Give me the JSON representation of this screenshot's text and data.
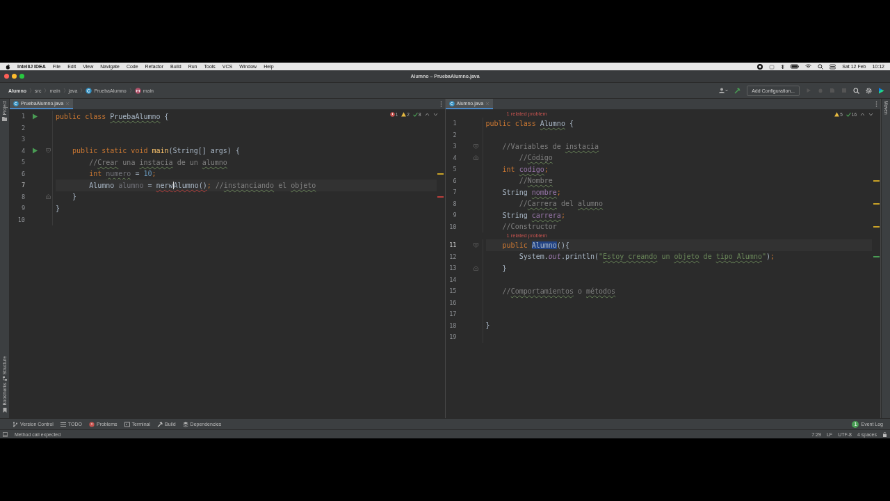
{
  "menubar": {
    "app": "IntelliJ IDEA",
    "items": [
      "File",
      "Edit",
      "View",
      "Navigate",
      "Code",
      "Refactor",
      "Build",
      "Run",
      "Tools",
      "VCS",
      "Window",
      "Help"
    ],
    "date": "Sat 12 Feb",
    "time": "10:12"
  },
  "window": {
    "title": "Alumno – PruebaAlumno.java"
  },
  "breadcrumbs": [
    {
      "text": "Alumno",
      "kind": "project"
    },
    {
      "text": "src",
      "kind": "folder"
    },
    {
      "text": "main",
      "kind": "folder"
    },
    {
      "text": "java",
      "kind": "folder"
    },
    {
      "text": "PruebaAlumno",
      "kind": "class"
    },
    {
      "text": "main",
      "kind": "method"
    }
  ],
  "toolbar": {
    "run_config": "Add Configuration..."
  },
  "side_left": [
    "Project",
    "Structure",
    "Bookmarks"
  ],
  "side_right": [
    "Maven"
  ],
  "panes": [
    {
      "tab": {
        "label": "PruebaAlumno.java",
        "selected": true
      },
      "inspections": [
        {
          "kind": "error",
          "count": "1"
        },
        {
          "kind": "warning",
          "count": "2"
        },
        {
          "kind": "ok",
          "count": "8"
        }
      ],
      "lines": [
        {
          "number": "1",
          "current": false,
          "run": true,
          "tokens": [
            {
              "text": "public class ",
              "kind": "keyword"
            },
            {
              "text": "PruebaAlumno",
              "kind": "plain",
              "typo": true
            },
            {
              "text": " {",
              "kind": "plain"
            }
          ]
        },
        {
          "number": "2",
          "current": false
        },
        {
          "number": "3",
          "current": false
        },
        {
          "number": "4",
          "current": false,
          "run": true,
          "fold_start": true,
          "tokens": [
            {
              "text": "    public static void ",
              "kind": "keyword"
            },
            {
              "text": "main",
              "kind": "method"
            },
            {
              "text": "(String[] args) {",
              "kind": "plain"
            }
          ]
        },
        {
          "number": "5",
          "current": false,
          "tokens": [
            {
              "text": "        //",
              "kind": "comment"
            },
            {
              "text": "Crear",
              "kind": "comment",
              "typo": true
            },
            {
              "text": " una ",
              "kind": "comment"
            },
            {
              "text": "instacia",
              "kind": "comment",
              "typo": true
            },
            {
              "text": " de un ",
              "kind": "comment"
            },
            {
              "text": "alumno",
              "kind": "comment",
              "typo": true
            }
          ]
        },
        {
          "number": "6",
          "current": false,
          "stripe": {
            "color": "#c9a227"
          },
          "tokens": [
            {
              "text": "        int ",
              "kind": "keyword"
            },
            {
              "text": "numero",
              "kind": "unused",
              "typo": true
            },
            {
              "text": " = ",
              "kind": "plain"
            },
            {
              "text": "10",
              "kind": "number"
            },
            {
              "text": ";",
              "kind": "keyword"
            }
          ]
        },
        {
          "number": "7",
          "current": true,
          "tokens": [
            {
              "text": "        Alumno ",
              "kind": "plain"
            },
            {
              "text": "alumno",
              "kind": "unused"
            },
            {
              "text": " = ",
              "kind": "plain"
            },
            {
              "text": "nerw",
              "kind": "plain",
              "error": true,
              "caret": true
            },
            {
              "text": "Alumno()",
              "kind": "plain",
              "error": true
            },
            {
              "text": ";",
              "kind": "keyword"
            },
            {
              "text": " //",
              "kind": "comment"
            },
            {
              "text": "instanciando",
              "kind": "comment",
              "typo": true
            },
            {
              "text": " el ",
              "kind": "comment"
            },
            {
              "text": "objeto",
              "kind": "comment",
              "typo": true
            }
          ]
        },
        {
          "number": "8",
          "current": false,
          "fold_end": true,
          "stripe": {
            "color": "#bc3f3c"
          },
          "tokens": [
            {
              "text": "    }",
              "kind": "plain"
            }
          ]
        },
        {
          "number": "9",
          "current": false,
          "tokens": [
            {
              "text": "}",
              "kind": "plain"
            }
          ]
        },
        {
          "number": "10",
          "current": false
        }
      ]
    },
    {
      "tab": {
        "label": "Alumno.java",
        "selected": true
      },
      "inspections": [
        {
          "kind": "warning",
          "count": "5"
        },
        {
          "kind": "ok",
          "count": "16"
        }
      ],
      "lines": [
        {
          "number": "1",
          "current": false,
          "inlay": "1 related problem",
          "tokens": [
            {
              "text": "public class ",
              "kind": "keyword"
            },
            {
              "text": "Alumno",
              "kind": "plain",
              "typo": true
            },
            {
              "text": " {",
              "kind": "plain"
            }
          ]
        },
        {
          "number": "2",
          "current": false
        },
        {
          "number": "3",
          "current": false,
          "fold_start": true,
          "tokens": [
            {
              "text": "    //Variables de ",
              "kind": "comment"
            },
            {
              "text": "instacia",
              "kind": "comment",
              "typo": true
            }
          ]
        },
        {
          "number": "4",
          "current": false,
          "fold_end": true,
          "tokens": [
            {
              "text": "        //",
              "kind": "comment"
            },
            {
              "text": "Código",
              "kind": "comment",
              "typo": true
            }
          ]
        },
        {
          "number": "5",
          "current": false,
          "tokens": [
            {
              "text": "    int ",
              "kind": "keyword"
            },
            {
              "text": "codigo",
              "kind": "field",
              "typo": true
            },
            {
              "text": ";",
              "kind": "keyword"
            }
          ]
        },
        {
          "number": "6",
          "current": false,
          "stripe": {
            "color": "#c9a227"
          },
          "tokens": [
            {
              "text": "        //",
              "kind": "comment"
            },
            {
              "text": "Nombre",
              "kind": "comment",
              "typo": true
            }
          ]
        },
        {
          "number": "7",
          "current": false,
          "tokens": [
            {
              "text": "    String ",
              "kind": "plain"
            },
            {
              "text": "nombre",
              "kind": "field",
              "typo": true
            },
            {
              "text": ";",
              "kind": "keyword"
            }
          ]
        },
        {
          "number": "8",
          "current": false,
          "stripe": {
            "color": "#c9a227"
          },
          "tokens": [
            {
              "text": "        //",
              "kind": "comment"
            },
            {
              "text": "Carrera",
              "kind": "comment",
              "typo": true
            },
            {
              "text": " del ",
              "kind": "comment"
            },
            {
              "text": "alumno",
              "kind": "comment",
              "typo": true
            }
          ]
        },
        {
          "number": "9",
          "current": false,
          "tokens": [
            {
              "text": "    String ",
              "kind": "plain"
            },
            {
              "text": "carrera",
              "kind": "field",
              "typo": true
            },
            {
              "text": ";",
              "kind": "keyword"
            }
          ]
        },
        {
          "number": "10",
          "current": false,
          "stripe": {
            "color": "#c9a227"
          },
          "tokens": [
            {
              "text": "    //Constructor",
              "kind": "comment"
            }
          ]
        },
        {
          "number": "11",
          "current": true,
          "fold_start": true,
          "inlay": "1 related problem",
          "tokens": [
            {
              "text": "    public ",
              "kind": "keyword"
            },
            {
              "text": "Alumno",
              "kind": "plain",
              "highlight": true
            },
            {
              "text": "(){",
              "kind": "plain"
            }
          ]
        },
        {
          "number": "12",
          "current": false,
          "stripe": {
            "color": "#499c54"
          },
          "tokens": [
            {
              "text": "        System.",
              "kind": "plain"
            },
            {
              "text": "out",
              "kind": "static"
            },
            {
              "text": ".println(",
              "kind": "plain"
            },
            {
              "text": "\"",
              "kind": "string"
            },
            {
              "text": "Estoy",
              "kind": "string",
              "typo": true
            },
            {
              "text": " creando",
              "kind": "string",
              "typo": true
            },
            {
              "text": " un ",
              "kind": "string"
            },
            {
              "text": "objeto",
              "kind": "string",
              "typo": true
            },
            {
              "text": " de ",
              "kind": "string"
            },
            {
              "text": "tipo",
              "kind": "string",
              "typo": true
            },
            {
              "text": " Alumno",
              "kind": "string",
              "typo": true
            },
            {
              "text": "\"",
              "kind": "string"
            },
            {
              "text": ")",
              "kind": "plain"
            },
            {
              "text": ";",
              "kind": "keyword"
            }
          ]
        },
        {
          "number": "13",
          "current": false,
          "fold_end": true,
          "tokens": [
            {
              "text": "    }",
              "kind": "plain"
            }
          ]
        },
        {
          "number": "14",
          "current": false
        },
        {
          "number": "15",
          "current": false,
          "tokens": [
            {
              "text": "    //",
              "kind": "comment"
            },
            {
              "text": "Comportamientos",
              "kind": "comment",
              "typo": true
            },
            {
              "text": " o ",
              "kind": "comment"
            },
            {
              "text": "métodos",
              "kind": "comment",
              "typo": true
            }
          ]
        },
        {
          "number": "16",
          "current": false
        },
        {
          "number": "17",
          "current": false
        },
        {
          "number": "18",
          "current": false,
          "tokens": [
            {
              "text": "}",
              "kind": "plain"
            }
          ]
        },
        {
          "number": "19",
          "current": false
        }
      ]
    }
  ],
  "tool_windows": [
    {
      "label": "Version Control",
      "kind": "vcs"
    },
    {
      "label": "TODO",
      "kind": "list"
    },
    {
      "label": "Problems",
      "kind": "problems"
    },
    {
      "label": "Terminal",
      "kind": "terminal"
    },
    {
      "label": "Build",
      "kind": "build"
    },
    {
      "label": "Dependencies",
      "kind": "deps"
    }
  ],
  "event_log": {
    "label": "Event Log",
    "badge": "1"
  },
  "status_bar": {
    "message": "Method call expected",
    "items": [
      "7:29",
      "LF",
      "UTF-8",
      "4 spaces"
    ]
  }
}
